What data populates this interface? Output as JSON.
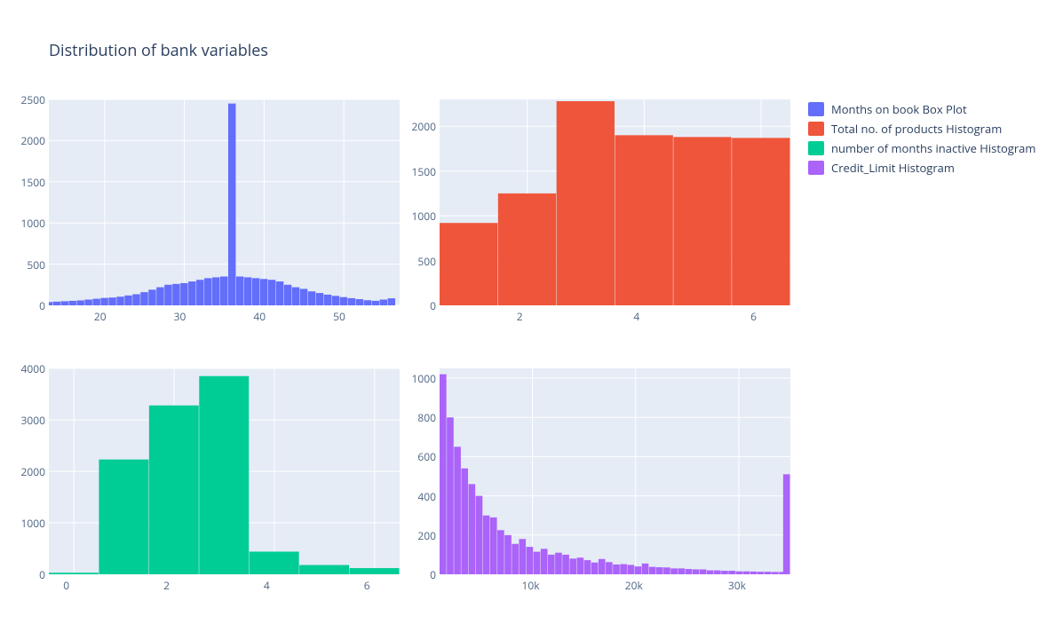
{
  "title": "Distribution of bank variables",
  "legend": [
    {
      "label": "Months on book Box Plot",
      "color": "#636efa"
    },
    {
      "label": "Total no. of products Histogram",
      "color": "#ef553b"
    },
    {
      "label": "number of months inactive Histogram",
      "color": "#00cc96"
    },
    {
      "label": "Credit_Limit Histogram",
      "color": "#ab63fa"
    }
  ],
  "chart_data": [
    {
      "id": "months_on_book",
      "type": "bar",
      "title": "",
      "xlabel": "",
      "ylabel": "",
      "xlim": [
        13,
        57
      ],
      "ylim": [
        0,
        2500
      ],
      "xticks": [
        20,
        30,
        40,
        50
      ],
      "yticks": [
        0,
        500,
        1000,
        1500,
        2000,
        2500
      ],
      "x": [
        13,
        14,
        15,
        16,
        17,
        18,
        19,
        20,
        21,
        22,
        23,
        24,
        25,
        26,
        27,
        28,
        29,
        30,
        31,
        32,
        33,
        34,
        35,
        36,
        37,
        38,
        39,
        40,
        41,
        42,
        43,
        44,
        45,
        46,
        47,
        48,
        49,
        50,
        51,
        52,
        53,
        54,
        55,
        56
      ],
      "values": [
        40,
        45,
        50,
        55,
        60,
        70,
        80,
        90,
        95,
        105,
        120,
        135,
        160,
        190,
        220,
        250,
        260,
        270,
        290,
        310,
        330,
        340,
        350,
        2450,
        350,
        340,
        330,
        320,
        310,
        290,
        250,
        220,
        200,
        170,
        150,
        130,
        115,
        100,
        87,
        75,
        62,
        55,
        70,
        85
      ]
    },
    {
      "id": "total_products",
      "type": "bar",
      "title": "",
      "xlabel": "",
      "ylabel": "",
      "xlim": [
        0.5,
        6.5
      ],
      "ylim": [
        0,
        2300
      ],
      "xticks": [
        2,
        4,
        6
      ],
      "yticks": [
        0,
        500,
        1000,
        1500,
        2000
      ],
      "x": [
        1,
        2,
        3,
        4,
        5,
        6
      ],
      "values": [
        920,
        1250,
        2280,
        1900,
        1880,
        1870
      ]
    },
    {
      "id": "months_inactive",
      "type": "bar",
      "title": "",
      "xlabel": "",
      "ylabel": "",
      "xlim": [
        -0.5,
        6.5
      ],
      "ylim": [
        0,
        4000
      ],
      "xticks": [
        0,
        2,
        4,
        6
      ],
      "yticks": [
        0,
        1000,
        2000,
        3000,
        4000
      ],
      "x": [
        0,
        1,
        2,
        3,
        4,
        5,
        6
      ],
      "values": [
        30,
        2230,
        3280,
        3850,
        440,
        180,
        120
      ]
    },
    {
      "id": "credit_limit",
      "type": "bar",
      "title": "",
      "xlabel": "",
      "ylabel": "",
      "xlim": [
        1000,
        35000
      ],
      "ylim": [
        0,
        1050
      ],
      "xticks": [
        10000,
        20000,
        30000
      ],
      "xtick_labels": [
        "10k",
        "20k",
        "30k"
      ],
      "yticks": [
        0,
        200,
        400,
        600,
        800,
        1000
      ],
      "bin_width": 700,
      "x": [
        1000,
        1700,
        2400,
        3100,
        3800,
        4500,
        5200,
        5900,
        6600,
        7300,
        8000,
        8700,
        9400,
        10100,
        10800,
        11500,
        12200,
        12900,
        13600,
        14300,
        15000,
        15700,
        16400,
        17100,
        17800,
        18500,
        19200,
        19900,
        20600,
        21300,
        22000,
        22700,
        23400,
        24100,
        24800,
        25500,
        26200,
        26900,
        27600,
        28300,
        29000,
        29700,
        30400,
        31100,
        31800,
        32500,
        33200,
        33900,
        34300
      ],
      "values": [
        1020,
        800,
        650,
        540,
        460,
        400,
        300,
        290,
        225,
        200,
        155,
        180,
        140,
        115,
        130,
        100,
        110,
        100,
        80,
        85,
        72,
        60,
        78,
        62,
        50,
        52,
        48,
        40,
        55,
        38,
        36,
        35,
        30,
        30,
        27,
        25,
        25,
        20,
        20,
        18,
        18,
        15,
        15,
        14,
        13,
        13,
        12,
        12,
        510
      ]
    }
  ]
}
